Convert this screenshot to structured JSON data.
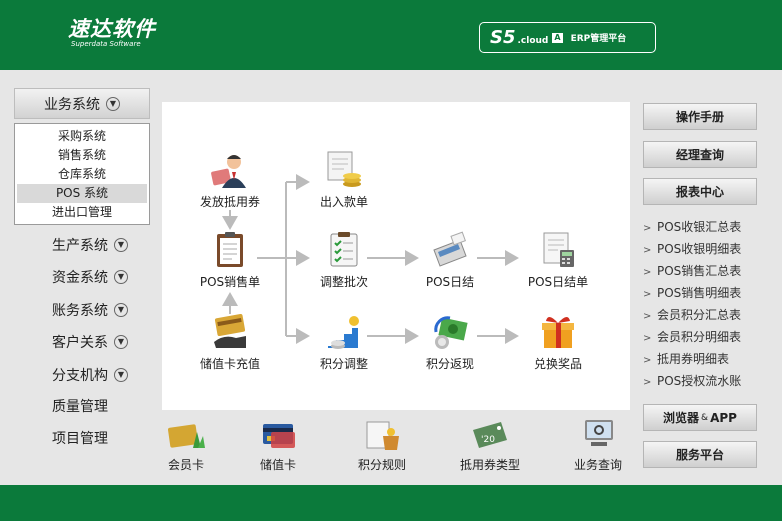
{
  "header": {
    "logo_main": "速达软件",
    "logo_sub": "Superdata Software",
    "badge_s5": "S5",
    "badge_cloud": ".cloud",
    "badge_a": "A",
    "badge_text": "ERP管理平台"
  },
  "left_menu": {
    "main_label": "业务系统",
    "sub_items": [
      {
        "label": "采购系统"
      },
      {
        "label": "销售系统"
      },
      {
        "label": "仓库系统"
      },
      {
        "label": "POS 系统"
      },
      {
        "label": "进出口管理"
      }
    ],
    "items": [
      {
        "label": "生产系统"
      },
      {
        "label": "资金系统"
      },
      {
        "label": "账务系统"
      },
      {
        "label": "客户关系"
      },
      {
        "label": "分支机构"
      },
      {
        "label": "质量管理"
      },
      {
        "label": "项目管理"
      }
    ]
  },
  "flow": {
    "issue_voucher": "发放抵用券",
    "in_out_receipt": "出入款单",
    "pos_sales": "POS销售单",
    "adjust_batch": "调整批次",
    "pos_daily": "POS日结",
    "pos_daily_report": "POS日结单",
    "card_topup": "储值卡充值",
    "points_adjust": "积分调整",
    "points_return": "积分返现",
    "redeem_prize": "兑换奖品"
  },
  "bottom": {
    "member_card": "会员卡",
    "stored_card": "储值卡",
    "points_rule": "积分规则",
    "voucher_type": "抵用券类型",
    "business_query": "业务查询"
  },
  "right": {
    "manual": "操作手册",
    "manager_query": "经理查询",
    "report_center": "报表中心",
    "reports": [
      {
        "label": "POS收银汇总表"
      },
      {
        "label": "POS收银明细表"
      },
      {
        "label": "POS销售汇总表"
      },
      {
        "label": "POS销售明细表"
      },
      {
        "label": "会员积分汇总表"
      },
      {
        "label": "会员积分明细表"
      },
      {
        "label": "抵用券明细表"
      },
      {
        "label": "POS授权流水账"
      }
    ],
    "browser_a": "浏览器",
    "browser_amp": "&",
    "browser_b": "APP",
    "service": "服务平台"
  },
  "colors": {
    "brand_green": "#0b7a3b",
    "background": "#e6e6e6",
    "flow_arrow": "#bbbbbb"
  }
}
